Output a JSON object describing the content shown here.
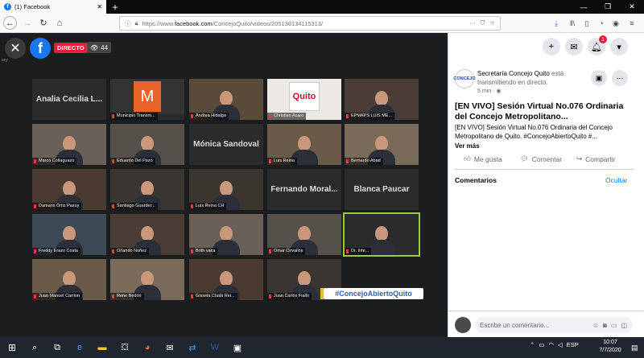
{
  "browser": {
    "tab_title": "(1) Facebook",
    "tab_close": "✕",
    "new_tab": "+",
    "url_prefix": "https://www.",
    "url_domain": "facebook.com",
    "url_path": "/ConcejoQuito/videos/205138134115313/",
    "win_min": "—",
    "win_max": "❐",
    "win_close": "✕"
  },
  "video": {
    "live_label": "DIRECTO",
    "viewer_count": "44",
    "hashtag": "#ConcejoAbiertoQuito",
    "corner_text": "any",
    "tiles": [
      {
        "name": "",
        "big": "Analia Cecilia L..."
      },
      {
        "name": "Municipio Transm...",
        "big": "M",
        "logo": "orange"
      },
      {
        "name": "Andrea Hidalgo",
        "big": ""
      },
      {
        "name": "Christian Acaro",
        "big": "Quito",
        "logo": "quito"
      },
      {
        "name": "EPMAPS LUIS ME...",
        "big": ""
      },
      {
        "name": "Marco Collaguazo",
        "big": ""
      },
      {
        "name": "Eduardo Del Pozo",
        "big": ""
      },
      {
        "name": "",
        "big": "Mónica Sandoval"
      },
      {
        "name": "Luis Reina",
        "big": ""
      },
      {
        "name": "Bernardo Abad",
        "big": ""
      },
      {
        "name": "Damaris Ortiz Pasuy",
        "big": ""
      },
      {
        "name": "Santiago Guarder...",
        "big": ""
      },
      {
        "name": "Luis Reina CH",
        "big": ""
      },
      {
        "name": "",
        "big": "Fernando Moral..."
      },
      {
        "name": "",
        "big": "Blanca Paucar"
      },
      {
        "name": "Freddy Erazo Costa",
        "big": ""
      },
      {
        "name": "Orlando Nuñez",
        "big": ""
      },
      {
        "name": "Brith vaca",
        "big": ""
      },
      {
        "name": "Omar Cevallos",
        "big": ""
      },
      {
        "name": "Dr. Inte...",
        "big": ""
      },
      {
        "name": "Juan Manuel Carrion",
        "big": ""
      },
      {
        "name": "Rene Bedón",
        "big": ""
      },
      {
        "name": "Gissela Chalá Rei...",
        "big": ""
      },
      {
        "name": "Juan Carlos Fiallo",
        "big": ""
      }
    ]
  },
  "post": {
    "page_name": "Secretaría Concejo Quito",
    "page_action": " está transmitiendo en directo.",
    "avatar_text": "CONCEJO",
    "time": "5 min · ◉",
    "title": "[EN VIVO] Sesión Virtual No.076 Ordinaria del Concejo Metropolitano...",
    "description": "[EN VIVO] Sesión Virtual No.076 Ordinaria del Concejo Metropolitano de Quito. #ConcejoAbiertoQuito #...",
    "see_more": "Ver más",
    "like": "Me gusta",
    "comment": "Comentar",
    "share": "Compartir",
    "comments_heading": "Comentarios",
    "hide": "Ocultar",
    "comment_placeholder": "Escribe un comentario...",
    "notif_count": "1"
  },
  "taskbar": {
    "lang": "ESP",
    "time": "10:07",
    "date": "7/7/2020"
  }
}
